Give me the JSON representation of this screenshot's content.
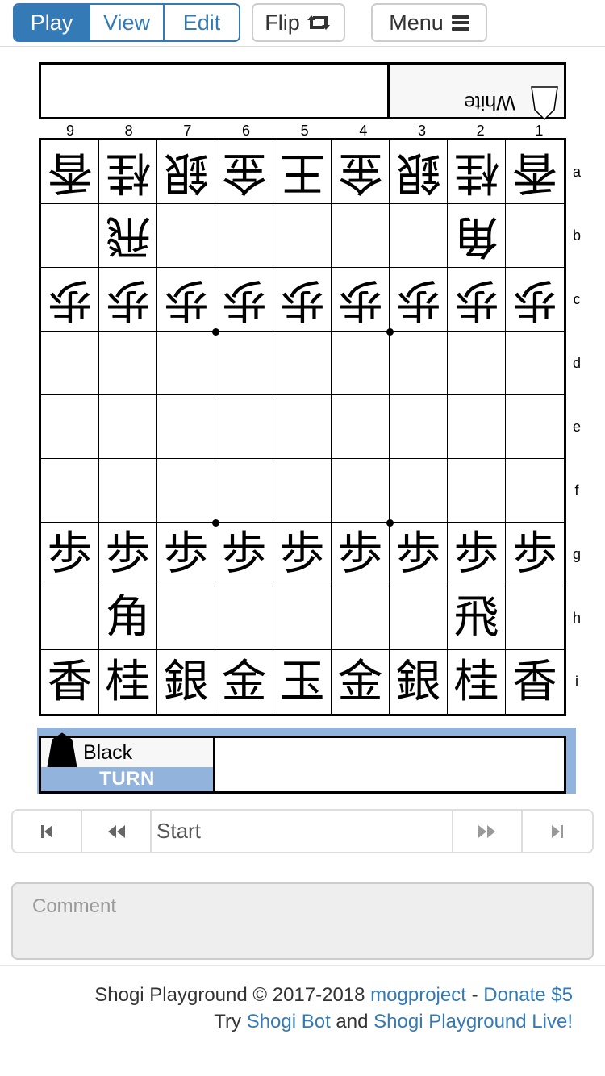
{
  "navbar": {
    "modes": [
      {
        "label": "Play",
        "active": true
      },
      {
        "label": "View",
        "active": false
      },
      {
        "label": "Edit",
        "active": false
      }
    ],
    "flip_label": "Flip",
    "flip_icon": "retweet-icon",
    "menu_label": "Menu",
    "menu_icon": "hamburger-icon"
  },
  "white_player": {
    "name": "White",
    "hand": []
  },
  "black_player": {
    "name": "Black",
    "turn_label": "TURN",
    "hand": []
  },
  "board": {
    "files": [
      "9",
      "8",
      "7",
      "6",
      "5",
      "4",
      "3",
      "2",
      "1"
    ],
    "ranks": [
      "a",
      "b",
      "c",
      "d",
      "e",
      "f",
      "g",
      "h",
      "i"
    ],
    "rows": [
      [
        "-香",
        "-桂",
        "-銀",
        "-金",
        "-王",
        "-金",
        "-銀",
        "-桂",
        "-香"
      ],
      [
        "",
        "-飛",
        "",
        "",
        "",
        "",
        "",
        "-角",
        ""
      ],
      [
        "-歩",
        "-歩",
        "-歩",
        "-歩",
        "-歩",
        "-歩",
        "-歩",
        "-歩",
        "-歩"
      ],
      [
        "",
        "",
        "",
        "",
        "",
        "",
        "",
        "",
        ""
      ],
      [
        "",
        "",
        "",
        "",
        "",
        "",
        "",
        "",
        ""
      ],
      [
        "",
        "",
        "",
        "",
        "",
        "",
        "",
        "",
        ""
      ],
      [
        "+歩",
        "+歩",
        "+歩",
        "+歩",
        "+歩",
        "+歩",
        "+歩",
        "+歩",
        "+歩"
      ],
      [
        "",
        "+角",
        "",
        "",
        "",
        "",
        "",
        "+飛",
        ""
      ],
      [
        "+香",
        "+桂",
        "+銀",
        "+金",
        "+玉",
        "+金",
        "+銀",
        "+桂",
        "+香"
      ]
    ]
  },
  "controls": {
    "first_icon": "skip-first-icon",
    "prev_icon": "step-back-icon",
    "position_label": "Start",
    "next_icon": "step-forward-icon",
    "last_icon": "skip-last-icon"
  },
  "comment": {
    "placeholder": "Comment",
    "value": ""
  },
  "footer": {
    "line1_text": "Shogi Playground © 2017-2018 ",
    "line1_link1": "mogproject",
    "line1_sep": " - ",
    "line1_link2": "Donate $5",
    "line2_text1": "Try ",
    "line2_link1": "Shogi Bot",
    "line2_text2": " and ",
    "line2_link2": "Shogi Playground Live!"
  },
  "colors": {
    "accent": "#337ab7",
    "turn_highlight": "#92b3dc",
    "panel_gray": "#f7f7f7"
  }
}
